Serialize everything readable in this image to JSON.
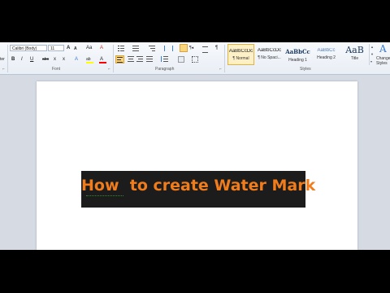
{
  "ribbon": {
    "font_group": {
      "label": "Font",
      "font_name": "Calibri (Body)",
      "font_size": "11",
      "grow_font": "A",
      "shrink_font": "A",
      "change_case": "Aa",
      "clear_format": "A",
      "bold": "B",
      "italic": "I",
      "underline": "U",
      "strikethrough": "abc",
      "subscript": "x",
      "superscript": "x",
      "text_effects": "A",
      "highlight": "ab",
      "font_color": "A"
    },
    "paragraph_group": {
      "label": "Paragraph",
      "pilcrow": "¶"
    },
    "styles_group": {
      "label": "Styles",
      "items": [
        {
          "sample": "AaBbCcDc",
          "name": "¶ Normal",
          "selected": true
        },
        {
          "sample": "AaBbCcDc",
          "name": "¶ No Spaci..."
        },
        {
          "sample": "AaBbCc",
          "name": "Heading 1"
        },
        {
          "sample": "AaBbCc",
          "name": "Heading 2"
        },
        {
          "sample": "AaB",
          "name": "Title"
        }
      ],
      "change_styles": "Change\nStyles"
    },
    "clipboard_fragment": "ter",
    "colors": {
      "highlight": "#ffff00",
      "font_color": "#ff0000",
      "heading": "#17365d",
      "heading2": "#4f81bd"
    }
  },
  "document": {
    "watermark_text": "How  to create Water Mark",
    "watermark_text_color": "#f07c1c",
    "watermark_bg": "#1c1c1c"
  }
}
